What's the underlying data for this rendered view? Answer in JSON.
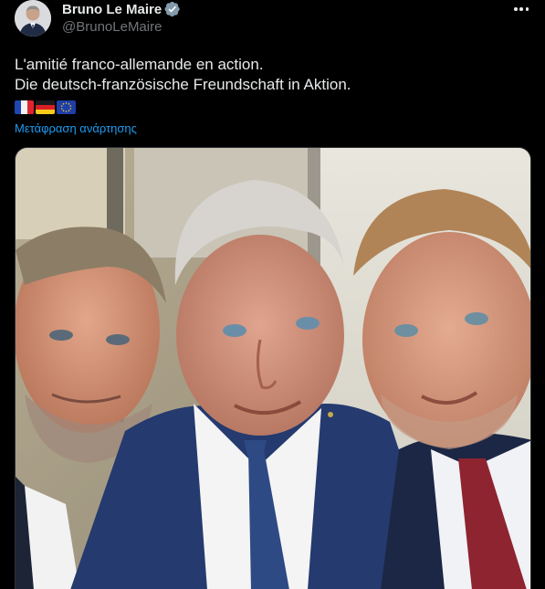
{
  "author": {
    "display_name": "Bruno Le Maire",
    "handle": "@BrunoLeMaire",
    "verified": true
  },
  "tweet": {
    "line1": "L'amitié franco-allemande en action.",
    "line2": "Die deutsch-französische Freundschaft in Aktion.",
    "flags": [
      "France",
      "Germany",
      "European Union"
    ],
    "translate_label": "Μετάφραση ανάρτησης"
  },
  "media": {
    "icons": [
      "photo"
    ]
  },
  "colors": {
    "background": "#000000",
    "text": "#e7e9ea",
    "secondary_text": "#71767b",
    "link": "#1d9bf0",
    "verified_badge": "#829aab"
  }
}
